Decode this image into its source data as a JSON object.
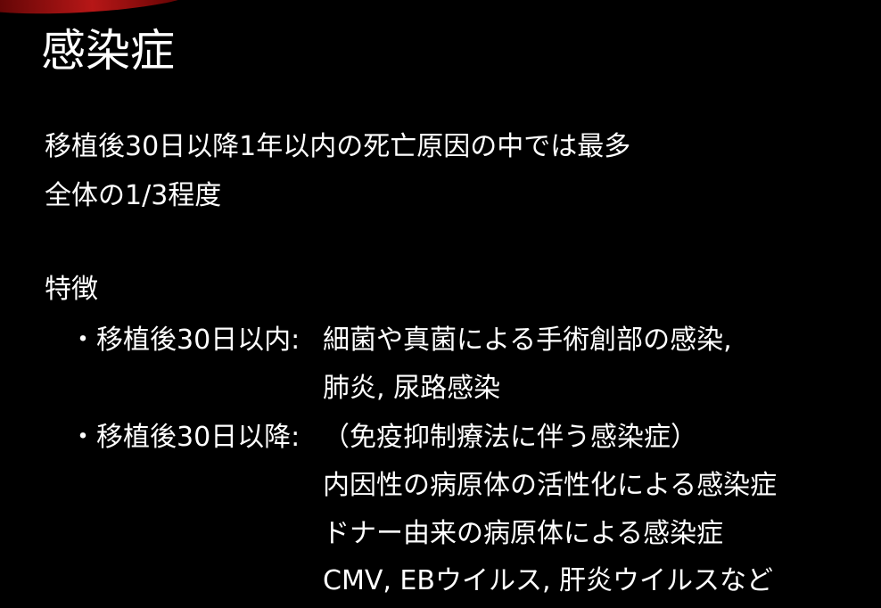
{
  "slide": {
    "title": "感染症",
    "intro": [
      "移植後30日以降1年以内の死亡原因の中では最多",
      "全体の1/3程度"
    ],
    "section_heading": "特徴",
    "bullets": [
      {
        "label": "・移植後30日以内:",
        "details": [
          "細菌や真菌による手術創部の感染,",
          "肺炎, 尿路感染"
        ]
      },
      {
        "label": "・移植後30日以降:",
        "details": [
          "（免疫抑制療法に伴う感染症）",
          "内因性の病原体の活性化による感染症",
          "ドナー由来の病原体による感染症",
          "CMV, EBウイルス, 肝炎ウイルスなど"
        ]
      }
    ],
    "colors": {
      "background": "#000000",
      "text": "#ffffff",
      "accent": "#c01818"
    }
  }
}
